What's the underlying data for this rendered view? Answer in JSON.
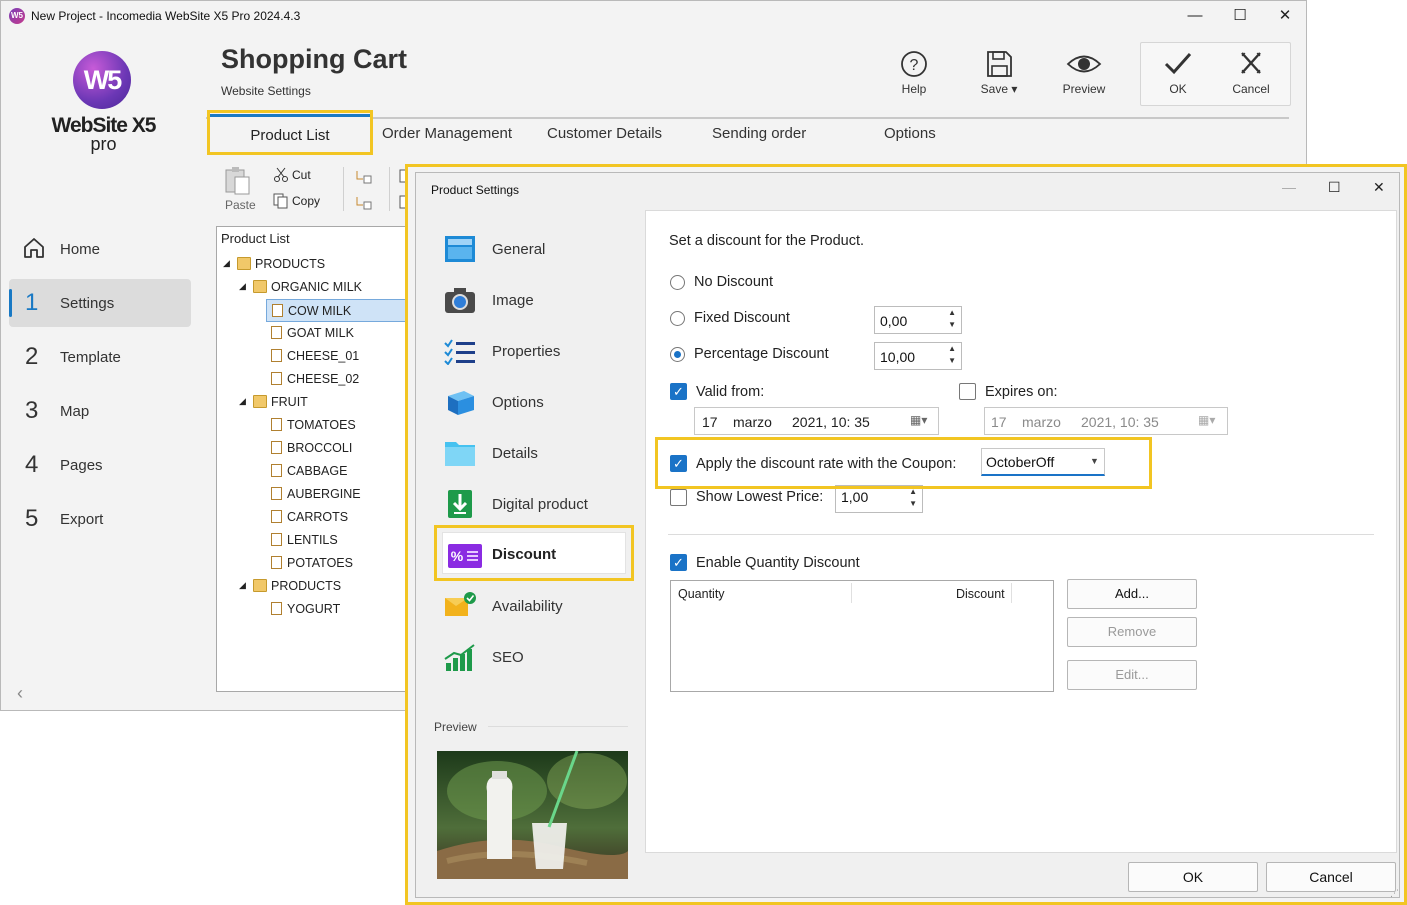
{
  "window": {
    "title": "New Project - Incomedia WebSite X5 Pro 2024.4.3",
    "minimize": "—",
    "maximize": "☐",
    "close": "✕"
  },
  "logo": {
    "name": "WebSite X5",
    "edition": "pro",
    "badge": "W5"
  },
  "sidebar": {
    "home_label": "Home",
    "items": [
      {
        "num": "1",
        "label": "Settings"
      },
      {
        "num": "2",
        "label": "Template"
      },
      {
        "num": "3",
        "label": "Map"
      },
      {
        "num": "4",
        "label": "Pages"
      },
      {
        "num": "5",
        "label": "Export"
      }
    ],
    "collapse_glyph": "‹"
  },
  "header": {
    "title": "Shopping Cart",
    "subtitle": "Website Settings"
  },
  "toolbar": {
    "help": "Help",
    "save": "Save",
    "preview": "Preview",
    "ok": "OK",
    "cancel": "Cancel"
  },
  "tabs": [
    "Product List",
    "Order Management",
    "Customer Details",
    "Sending order",
    "Options"
  ],
  "edit_toolbar": {
    "paste": "Paste",
    "cut": "Cut",
    "copy": "Copy"
  },
  "product_list": {
    "header": "Product List",
    "rows": [
      {
        "label": "PRODUCTS",
        "level": 0,
        "type": "folder",
        "expanded": true
      },
      {
        "label": "ORGANIC MILK",
        "level": 1,
        "type": "folder",
        "expanded": true
      },
      {
        "label": "COW MILK",
        "level": 2,
        "type": "doc",
        "selected": true
      },
      {
        "label": "GOAT MILK",
        "level": 2,
        "type": "doc"
      },
      {
        "label": "CHEESE_01",
        "level": 2,
        "type": "doc"
      },
      {
        "label": "CHEESE_02",
        "level": 2,
        "type": "doc"
      },
      {
        "label": "FRUIT",
        "level": 1,
        "type": "folder",
        "expanded": true
      },
      {
        "label": "TOMATOES",
        "level": 2,
        "type": "doc"
      },
      {
        "label": "BROCCOLI",
        "level": 2,
        "type": "doc"
      },
      {
        "label": "CABBAGE",
        "level": 2,
        "type": "doc"
      },
      {
        "label": "AUBERGINE",
        "level": 2,
        "type": "doc"
      },
      {
        "label": "CARROTS",
        "level": 2,
        "type": "doc"
      },
      {
        "label": "LENTILS",
        "level": 2,
        "type": "doc"
      },
      {
        "label": "POTATOES",
        "level": 2,
        "type": "doc"
      },
      {
        "label": "PRODUCTS",
        "level": 1,
        "type": "folder",
        "expanded": true
      },
      {
        "label": "YOGURT",
        "level": 2,
        "type": "doc"
      }
    ]
  },
  "dialog": {
    "title": "Product Settings",
    "side_items": [
      {
        "label": "General",
        "icon": "general-icon"
      },
      {
        "label": "Image",
        "icon": "camera-icon"
      },
      {
        "label": "Properties",
        "icon": "list-icon"
      },
      {
        "label": "Options",
        "icon": "options-cube-icon"
      },
      {
        "label": "Details",
        "icon": "folder-details-icon"
      },
      {
        "label": "Digital product",
        "icon": "download-icon"
      },
      {
        "label": "Discount",
        "icon": "discount-icon",
        "active": true
      },
      {
        "label": "Availability",
        "icon": "availability-icon"
      },
      {
        "label": "SEO",
        "icon": "seo-chart-icon"
      }
    ],
    "preview_label": "Preview",
    "intro": "Set a discount for the Product.",
    "no_discount": "No Discount",
    "fixed_discount": "Fixed Discount",
    "fixed_value": "0,00",
    "percentage_discount": "Percentage Discount",
    "percentage_value": "10,00",
    "selected_discount": "Percentage Discount",
    "valid_from": {
      "label": "Valid from:",
      "checked": true,
      "day": "17",
      "month": "marzo",
      "time": "2021, 10: 35"
    },
    "expires_on": {
      "label": "Expires on:",
      "checked": false,
      "day": "17",
      "month": "marzo",
      "time": "2021, 10: 35"
    },
    "coupon": {
      "label": "Apply the discount rate with the Coupon:",
      "checked": true,
      "value": "OctoberOff"
    },
    "lowest_price": {
      "label": "Show Lowest Price:",
      "checked": false,
      "value": "1,00"
    },
    "quantity_discount": {
      "label": "Enable Quantity Discount",
      "checked": true,
      "col_quantity": "Quantity",
      "col_discount": "Discount"
    },
    "buttons": {
      "add": "Add...",
      "remove": "Remove",
      "edit": "Edit..."
    },
    "ok": "OK",
    "cancel": "Cancel"
  },
  "colors": {
    "highlight": "#f2c522",
    "accent": "#1979c4",
    "check_blue": "#1a73c7"
  }
}
